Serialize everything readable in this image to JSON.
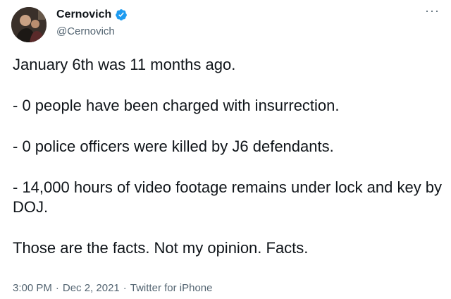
{
  "author": {
    "display_name": "Cernovich",
    "handle": "@Cernovich",
    "verified": true
  },
  "menu": {
    "more_label": "···"
  },
  "tweet": {
    "line1": "January 6th was 11 months ago.",
    "line2": "- 0 people have been charged with insurrection.",
    "line3": "- 0 police officers were killed by J6 defendants.",
    "line4": "- 14,000 hours of video footage remains under lock and key by DOJ.",
    "line5": "Those are the facts. Not my opinion. Facts."
  },
  "meta": {
    "time": "3:00 PM",
    "sep1": "·",
    "date": "Dec 2, 2021",
    "sep2": "·",
    "source": "Twitter for iPhone"
  },
  "colors": {
    "verified_badge": "#1d9bf0",
    "text_primary": "#0f1419",
    "text_secondary": "#536471"
  }
}
